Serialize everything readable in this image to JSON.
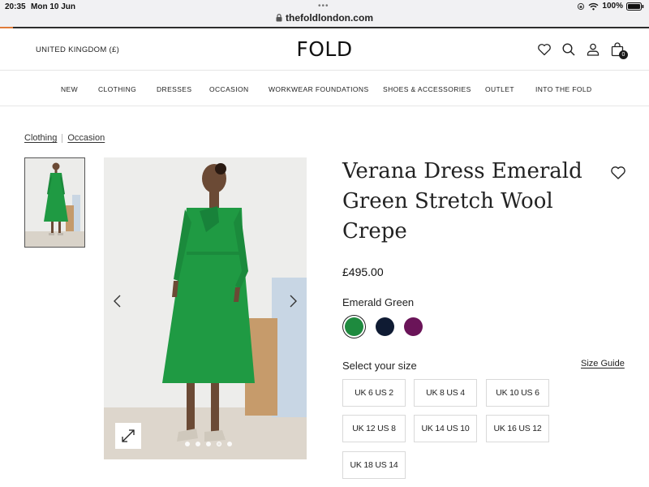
{
  "status_bar": {
    "time": "20:35",
    "date": "Mon 10 Jun",
    "url": "thefoldlondon.com",
    "battery": "100%"
  },
  "header": {
    "region": "UNITED KINGDOM (£)",
    "logo_text": "FOLD",
    "bag_count": "0"
  },
  "nav": {
    "items": [
      "NEW",
      "CLOTHING",
      "DRESSES",
      "OCCASION",
      "WORKWEAR FOUNDATIONS",
      "SHOES & ACCESSORIES",
      "OUTLET",
      "INTO THE FOLD"
    ]
  },
  "breadcrumb": [
    "Clothing",
    "Occasion"
  ],
  "product": {
    "title_lines": [
      "Verana Dress Emerald",
      "Green Stretch Wool",
      "Crepe"
    ],
    "price": "£495.00",
    "color_name": "Emerald Green",
    "swatches": [
      {
        "name": "Emerald Green",
        "color": "#1e8a3e",
        "selected": true
      },
      {
        "name": "Navy",
        "color": "#0f1b33",
        "selected": false
      },
      {
        "name": "Plum",
        "color": "#6a1458",
        "selected": false
      }
    ],
    "size_label": "Select your size",
    "size_guide": "Size Guide",
    "sizes": [
      "UK 6 US 2",
      "UK 8 US 4",
      "UK 10 US 6",
      "UK 12 US 8",
      "UK 14 US 10",
      "UK 16 US 12",
      "UK 18 US 14"
    ]
  },
  "gallery": {
    "dot_count": 5,
    "active_dot": 3,
    "dress_color": "#1f9a43"
  }
}
